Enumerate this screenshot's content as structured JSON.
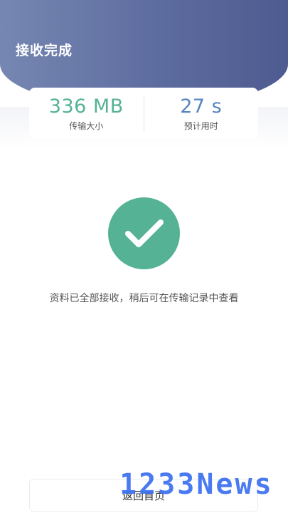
{
  "header": {
    "title": "接收完成"
  },
  "stats": {
    "size_value": "336 MB",
    "size_label": "传输大小",
    "time_value": "27 s",
    "time_label": "预计用时"
  },
  "status": {
    "icon": "check-icon",
    "message": "资料已全部接收，稍后可在传输记录中查看"
  },
  "actions": {
    "home_label": "返回首页"
  },
  "watermark": {
    "text": "1233News"
  },
  "colors": {
    "success": "#55b295",
    "time_accent": "#5885c0",
    "header_start": "#7687b2",
    "header_end": "#4e5b90",
    "watermark": "#3b6ff0"
  }
}
